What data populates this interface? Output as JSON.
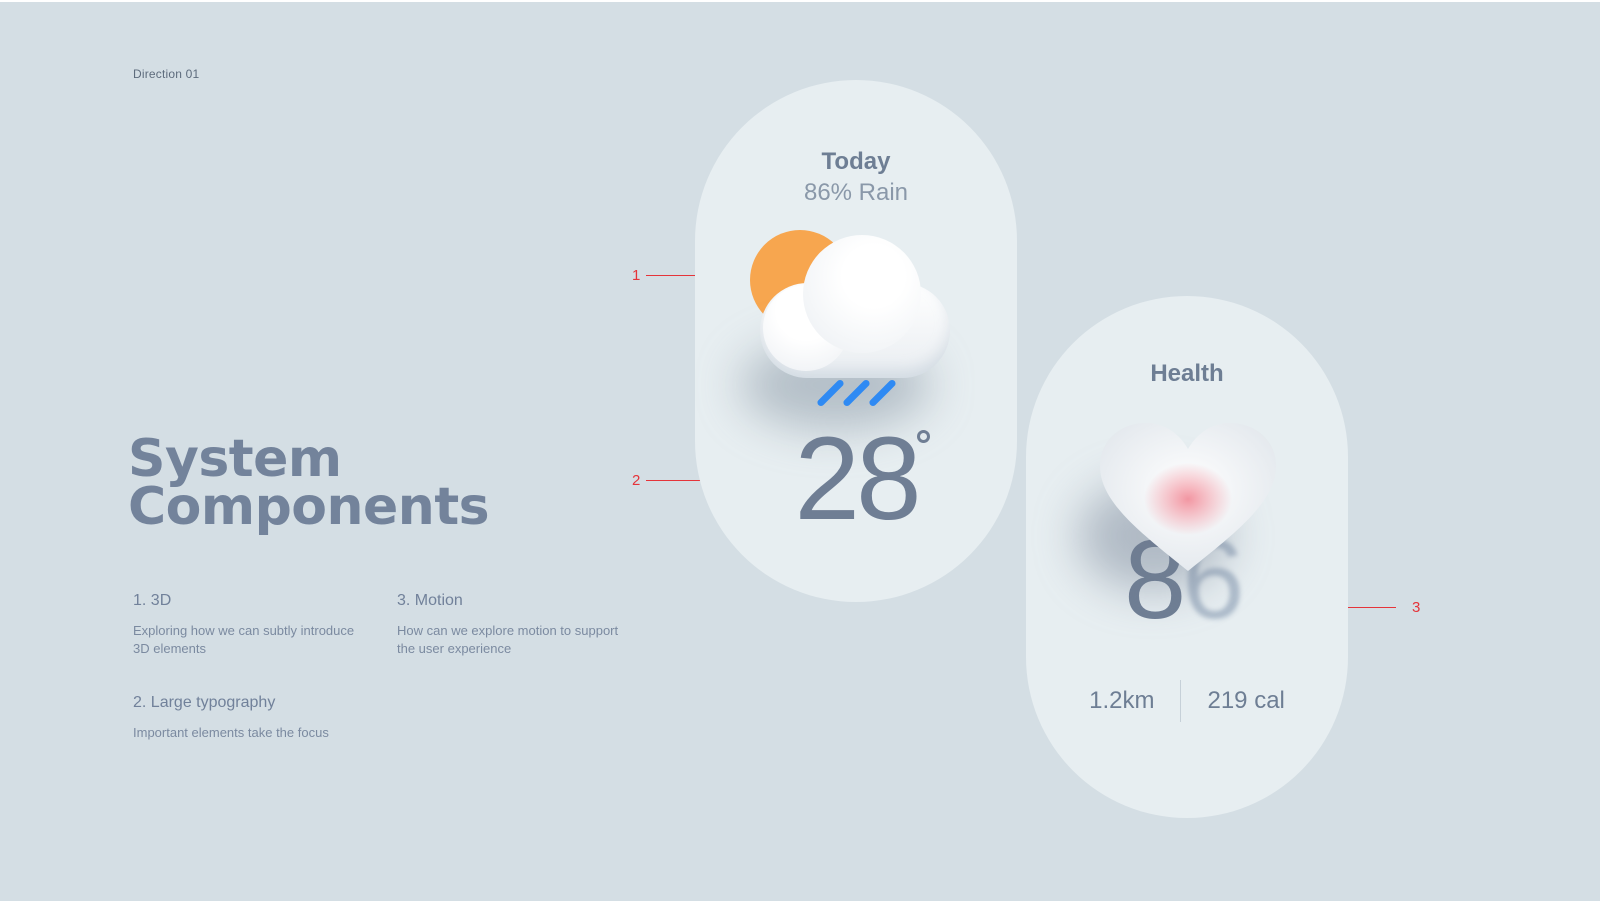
{
  "direction_label": "Direction 01",
  "title": {
    "line1": "System",
    "line2": "Components"
  },
  "features": [
    {
      "heading": "1. 3D",
      "text": "Exploring how we can subtly introduce 3D elements"
    },
    {
      "heading": "2. Large typography",
      "text": "Important elements take the focus"
    },
    {
      "heading": "3. Motion",
      "text": "How can we explore motion to support the user experience"
    }
  ],
  "markers": [
    "1",
    "2",
    "3"
  ],
  "weather_card": {
    "title": "Today",
    "subtitle": "86% Rain",
    "temperature": "28",
    "icon": "sun-cloud-rain-icon"
  },
  "health_card": {
    "title": "Health",
    "bpm": "86",
    "icon": "heart-icon",
    "distance": "1.2km",
    "calories": "219 cal"
  },
  "colors": {
    "background": "#d4dee4",
    "card": "#e7eef1",
    "text": "#6e7e94",
    "marker": "#e5343a",
    "sun": "#f7a64f",
    "rain": "#2f8af3",
    "heart_glow": "#f18b98"
  }
}
